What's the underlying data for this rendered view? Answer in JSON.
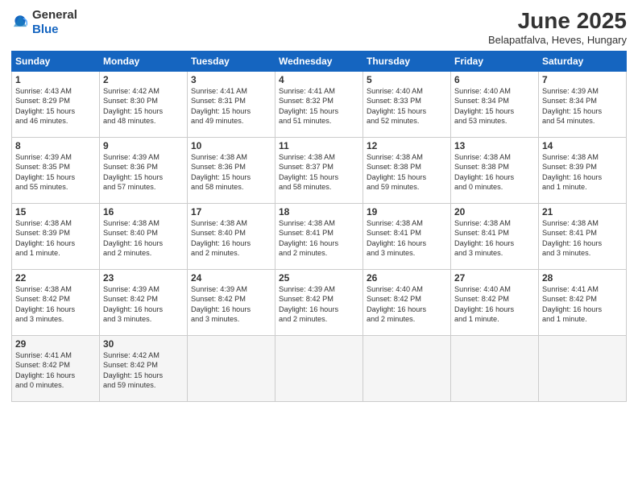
{
  "header": {
    "logo_general": "General",
    "logo_blue": "Blue",
    "title": "June 2025",
    "subtitle": "Belapatfalva, Heves, Hungary"
  },
  "weekdays": [
    "Sunday",
    "Monday",
    "Tuesday",
    "Wednesday",
    "Thursday",
    "Friday",
    "Saturday"
  ],
  "weeks": [
    [
      {
        "day": "1",
        "info": "Sunrise: 4:43 AM\nSunset: 8:29 PM\nDaylight: 15 hours\nand 46 minutes."
      },
      {
        "day": "2",
        "info": "Sunrise: 4:42 AM\nSunset: 8:30 PM\nDaylight: 15 hours\nand 48 minutes."
      },
      {
        "day": "3",
        "info": "Sunrise: 4:41 AM\nSunset: 8:31 PM\nDaylight: 15 hours\nand 49 minutes."
      },
      {
        "day": "4",
        "info": "Sunrise: 4:41 AM\nSunset: 8:32 PM\nDaylight: 15 hours\nand 51 minutes."
      },
      {
        "day": "5",
        "info": "Sunrise: 4:40 AM\nSunset: 8:33 PM\nDaylight: 15 hours\nand 52 minutes."
      },
      {
        "day": "6",
        "info": "Sunrise: 4:40 AM\nSunset: 8:34 PM\nDaylight: 15 hours\nand 53 minutes."
      },
      {
        "day": "7",
        "info": "Sunrise: 4:39 AM\nSunset: 8:34 PM\nDaylight: 15 hours\nand 54 minutes."
      }
    ],
    [
      {
        "day": "8",
        "info": "Sunrise: 4:39 AM\nSunset: 8:35 PM\nDaylight: 15 hours\nand 55 minutes."
      },
      {
        "day": "9",
        "info": "Sunrise: 4:39 AM\nSunset: 8:36 PM\nDaylight: 15 hours\nand 57 minutes."
      },
      {
        "day": "10",
        "info": "Sunrise: 4:38 AM\nSunset: 8:36 PM\nDaylight: 15 hours\nand 58 minutes."
      },
      {
        "day": "11",
        "info": "Sunrise: 4:38 AM\nSunset: 8:37 PM\nDaylight: 15 hours\nand 58 minutes."
      },
      {
        "day": "12",
        "info": "Sunrise: 4:38 AM\nSunset: 8:38 PM\nDaylight: 15 hours\nand 59 minutes."
      },
      {
        "day": "13",
        "info": "Sunrise: 4:38 AM\nSunset: 8:38 PM\nDaylight: 16 hours\nand 0 minutes."
      },
      {
        "day": "14",
        "info": "Sunrise: 4:38 AM\nSunset: 8:39 PM\nDaylight: 16 hours\nand 1 minute."
      }
    ],
    [
      {
        "day": "15",
        "info": "Sunrise: 4:38 AM\nSunset: 8:39 PM\nDaylight: 16 hours\nand 1 minute."
      },
      {
        "day": "16",
        "info": "Sunrise: 4:38 AM\nSunset: 8:40 PM\nDaylight: 16 hours\nand 2 minutes."
      },
      {
        "day": "17",
        "info": "Sunrise: 4:38 AM\nSunset: 8:40 PM\nDaylight: 16 hours\nand 2 minutes."
      },
      {
        "day": "18",
        "info": "Sunrise: 4:38 AM\nSunset: 8:41 PM\nDaylight: 16 hours\nand 2 minutes."
      },
      {
        "day": "19",
        "info": "Sunrise: 4:38 AM\nSunset: 8:41 PM\nDaylight: 16 hours\nand 3 minutes."
      },
      {
        "day": "20",
        "info": "Sunrise: 4:38 AM\nSunset: 8:41 PM\nDaylight: 16 hours\nand 3 minutes."
      },
      {
        "day": "21",
        "info": "Sunrise: 4:38 AM\nSunset: 8:41 PM\nDaylight: 16 hours\nand 3 minutes."
      }
    ],
    [
      {
        "day": "22",
        "info": "Sunrise: 4:38 AM\nSunset: 8:42 PM\nDaylight: 16 hours\nand 3 minutes."
      },
      {
        "day": "23",
        "info": "Sunrise: 4:39 AM\nSunset: 8:42 PM\nDaylight: 16 hours\nand 3 minutes."
      },
      {
        "day": "24",
        "info": "Sunrise: 4:39 AM\nSunset: 8:42 PM\nDaylight: 16 hours\nand 3 minutes."
      },
      {
        "day": "25",
        "info": "Sunrise: 4:39 AM\nSunset: 8:42 PM\nDaylight: 16 hours\nand 2 minutes."
      },
      {
        "day": "26",
        "info": "Sunrise: 4:40 AM\nSunset: 8:42 PM\nDaylight: 16 hours\nand 2 minutes."
      },
      {
        "day": "27",
        "info": "Sunrise: 4:40 AM\nSunset: 8:42 PM\nDaylight: 16 hours\nand 1 minute."
      },
      {
        "day": "28",
        "info": "Sunrise: 4:41 AM\nSunset: 8:42 PM\nDaylight: 16 hours\nand 1 minute."
      }
    ],
    [
      {
        "day": "29",
        "info": "Sunrise: 4:41 AM\nSunset: 8:42 PM\nDaylight: 16 hours\nand 0 minutes."
      },
      {
        "day": "30",
        "info": "Sunrise: 4:42 AM\nSunset: 8:42 PM\nDaylight: 15 hours\nand 59 minutes."
      },
      {
        "day": "",
        "info": ""
      },
      {
        "day": "",
        "info": ""
      },
      {
        "day": "",
        "info": ""
      },
      {
        "day": "",
        "info": ""
      },
      {
        "day": "",
        "info": ""
      }
    ]
  ]
}
